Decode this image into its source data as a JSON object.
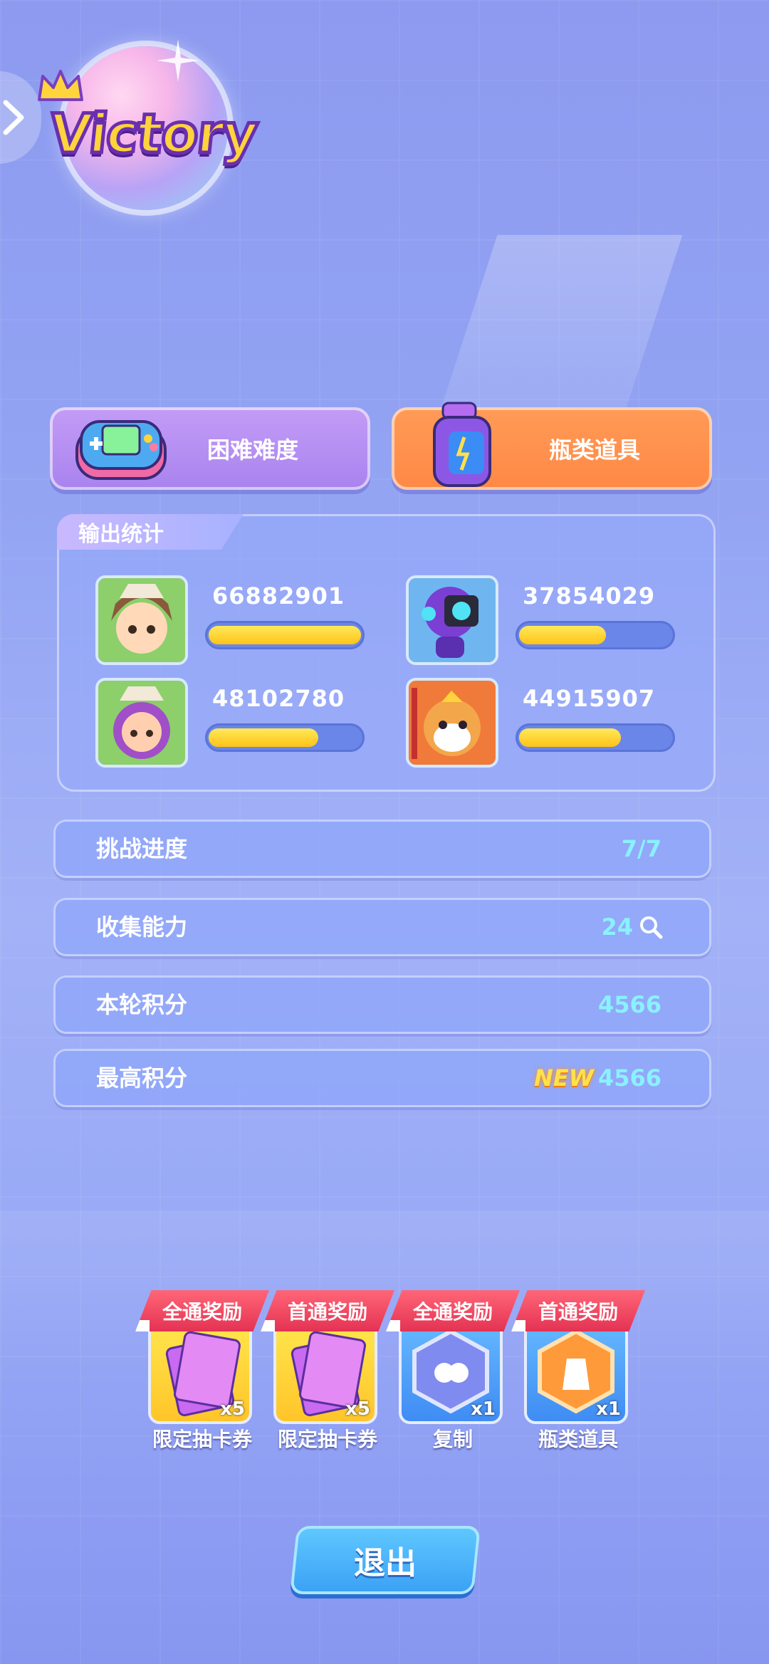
{
  "header": {
    "title": "Victory"
  },
  "categories": [
    {
      "label": "困难难度",
      "color": "#a983ee"
    },
    {
      "label": "瓶类道具",
      "color": "#ff8845"
    }
  ],
  "stats": {
    "tab_label": "输出统计",
    "heroes": [
      {
        "value": "66882901",
        "fill": 1.0
      },
      {
        "value": "37854029",
        "fill": 0.57
      },
      {
        "value": "48102780",
        "fill": 0.72
      },
      {
        "value": "44915907",
        "fill": 0.67
      }
    ]
  },
  "rows": [
    {
      "label": "挑战进度",
      "value": "7/7"
    },
    {
      "label": "收集能力",
      "value": "24"
    },
    {
      "label": "本轮积分",
      "value": "4566"
    },
    {
      "label": "最高积分",
      "value": "4566",
      "tag": "NEW"
    }
  ],
  "rewards": [
    {
      "banner": "全通奖励",
      "name": "限定抽卡券",
      "qty": "x5"
    },
    {
      "banner": "首通奖励",
      "name": "限定抽卡券",
      "qty": "x5"
    },
    {
      "banner": "全通奖励",
      "name": "复制",
      "qty": "x1"
    },
    {
      "banner": "首通奖励",
      "name": "瓶类道具",
      "qty": "x1"
    }
  ],
  "exit_label": "退出"
}
